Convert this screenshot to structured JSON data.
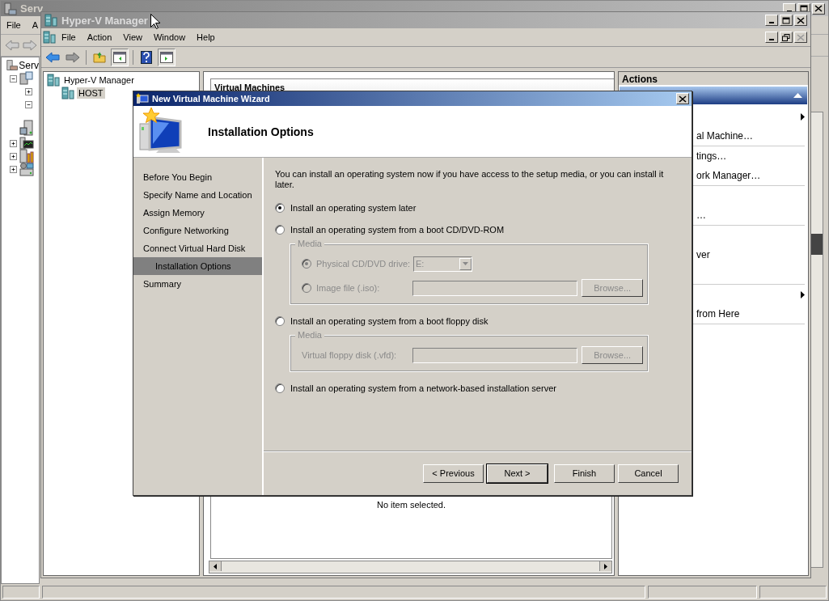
{
  "server_manager": {
    "title": "Serv",
    "menu": [
      "File",
      "A"
    ],
    "tree": [
      {
        "label": "Serv",
        "children": [
          {
            "kind": "roles",
            "expanded": true,
            "children": [
              {
                "expanded": false
              },
              {
                "expanded": true
              }
            ]
          },
          {
            "kind": "diagnostics"
          },
          {
            "kind": "monitor",
            "expanded": false
          },
          {
            "kind": "config",
            "expanded": false
          },
          {
            "kind": "storage",
            "expanded": false
          }
        ]
      }
    ]
  },
  "hyperv": {
    "title": "Hyper-V Manager",
    "menu": [
      "File",
      "Action",
      "View",
      "Window",
      "Help"
    ],
    "tree": [
      {
        "label": "Hyper-V Manager",
        "selected": false,
        "children": [
          {
            "label": "HOST",
            "selected": true
          }
        ]
      }
    ],
    "center": {
      "header": "Virtual Machines",
      "details": "No item selected."
    },
    "actions": {
      "header": "Actions",
      "items": [
        {
          "kind": "submenu"
        },
        {
          "kind": "text",
          "label": "al Machine…"
        },
        {
          "kind": "separator"
        },
        {
          "kind": "text",
          "label": "tings…"
        },
        {
          "kind": "text",
          "label": "ork Manager…"
        },
        {
          "kind": "separator"
        },
        {
          "kind": "blank"
        },
        {
          "kind": "text",
          "label": "…"
        },
        {
          "kind": "separator"
        },
        {
          "kind": "blank"
        },
        {
          "kind": "text",
          "label": "ver"
        },
        {
          "kind": "blank"
        },
        {
          "kind": "separator"
        },
        {
          "kind": "submenu"
        },
        {
          "kind": "text",
          "label": "from Here"
        },
        {
          "kind": "separator"
        }
      ]
    }
  },
  "wizard": {
    "title": "New Virtual Machine Wizard",
    "heading": "Installation Options",
    "steps": [
      {
        "label": "Before You Begin",
        "selected": false
      },
      {
        "label": "Specify Name and Location",
        "selected": false
      },
      {
        "label": "Assign Memory",
        "selected": false
      },
      {
        "label": "Configure Networking",
        "selected": false
      },
      {
        "label": "Connect Virtual Hard Disk",
        "selected": false
      },
      {
        "label": "Installation Options",
        "selected": true
      },
      {
        "label": "Summary",
        "selected": false
      }
    ],
    "intro": "You can install an operating system now if you have access to the setup media, or you can install it later.",
    "options": [
      {
        "label": "Install an operating system later",
        "selected": true
      },
      {
        "label": "Install an operating system from a boot CD/DVD-ROM",
        "selected": false,
        "media": {
          "legend": "Media",
          "disabled": true,
          "rows": [
            {
              "kind": "drive",
              "label": "Physical CD/DVD drive:",
              "selected": true,
              "value": "E:"
            },
            {
              "kind": "file",
              "label": "Image file (.iso):",
              "selected": false,
              "button": "Browse..."
            }
          ]
        }
      },
      {
        "label": "Install an operating system from a boot floppy disk",
        "selected": false,
        "media": {
          "legend": "Media",
          "disabled": true,
          "rows": [
            {
              "kind": "plainfile",
              "label": "Virtual floppy disk (.vfd):",
              "button": "Browse..."
            }
          ]
        }
      },
      {
        "label": "Install an operating system from a network-based installation server",
        "selected": false
      }
    ],
    "buttons": [
      {
        "label": "< Previous",
        "default": false
      },
      {
        "label": "Next >",
        "default": true
      },
      {
        "label": "Finish",
        "default": false
      },
      {
        "label": "Cancel",
        "default": false
      }
    ]
  }
}
